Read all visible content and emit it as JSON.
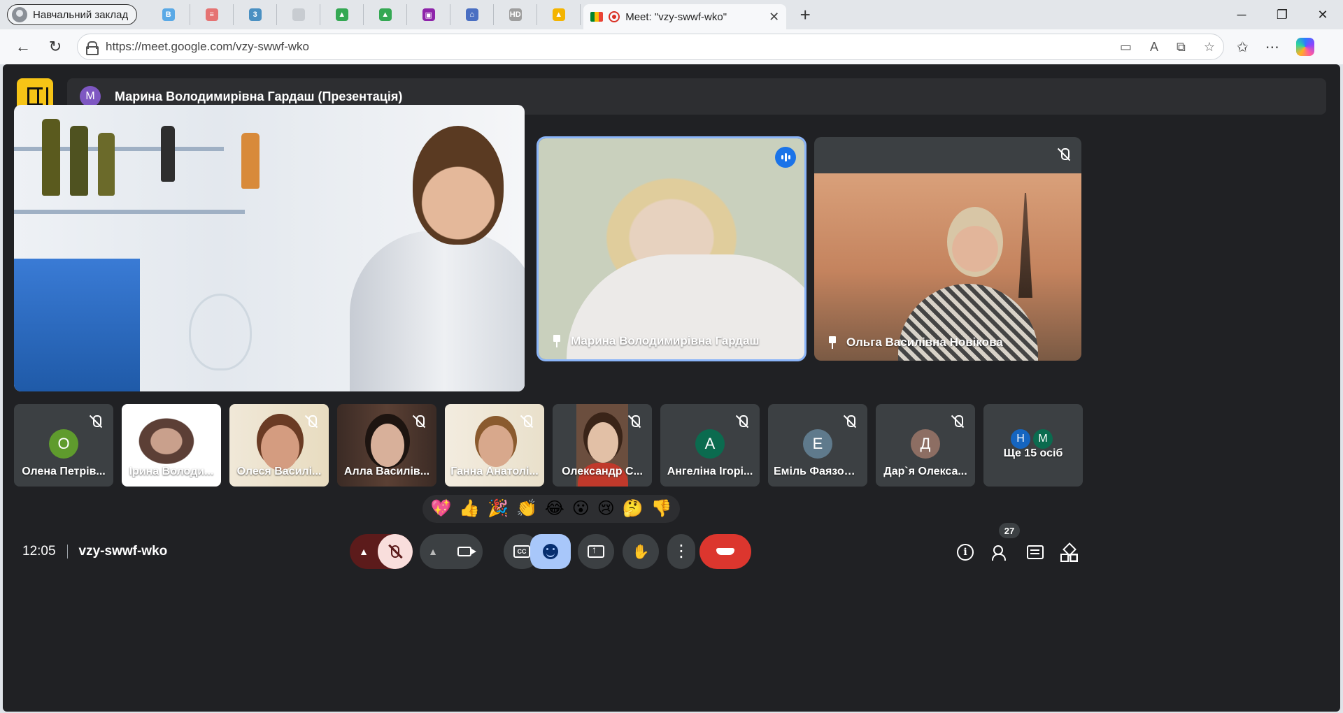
{
  "browser": {
    "profile_label": "Навчальний заклад",
    "mini_tabs": [
      {
        "icon": "bookmark-b-icon",
        "color": "#5aa9e6",
        "glyph": "B"
      },
      {
        "icon": "book-icon",
        "color": "#e57373",
        "glyph": "≡"
      },
      {
        "icon": "calendar-icon",
        "color": "#4a90c2",
        "glyph": "3"
      },
      {
        "icon": "blank-tab-icon",
        "color": "#c8ccd1",
        "glyph": ""
      },
      {
        "icon": "drive-icon",
        "color": "#34a853",
        "glyph": "▲"
      },
      {
        "icon": "drive-icon-2",
        "color": "#34a853",
        "glyph": "▲"
      },
      {
        "icon": "contacts-icon",
        "color": "#8e24aa",
        "glyph": "▣"
      },
      {
        "icon": "home-icon",
        "color": "#4a6fc2",
        "glyph": "⌂"
      },
      {
        "icon": "hd-icon",
        "color": "#9e9e9e",
        "glyph": "HD"
      },
      {
        "icon": "bell-icon",
        "color": "#f4b400",
        "glyph": "▲"
      }
    ],
    "active_tab_title": "Meet: \"vzy-swwf-wko\"",
    "url": "https://meet.google.com/vzy-swwf-wko"
  },
  "meet": {
    "presenter_avatar_letter": "M",
    "presenter_label": "Марина Володимирівна Гардаш (Презентація)",
    "featured": [
      {
        "name": "Марина Володимирівна Гардаш"
      },
      {
        "name": "Ольга Василівна Новікова"
      }
    ],
    "strip": [
      {
        "name": "Олена Петрів...",
        "avatar_letter": "О",
        "avatar_color": "#5f9b2d"
      },
      {
        "name": "Ірина Володи..."
      },
      {
        "name": "Олеся Василі..."
      },
      {
        "name": "Алла Василів..."
      },
      {
        "name": "Ганна Анатолі..."
      },
      {
        "name": "Олександр С..."
      },
      {
        "name": "Ангеліна Ігорі...",
        "avatar_letter": "А",
        "avatar_color": "#0b6b4f"
      },
      {
        "name": "Еміль Фаязові...",
        "avatar_letter": "Е",
        "avatar_color": "#5f7a8c"
      },
      {
        "name": "Дар`я Олекса...",
        "avatar_letter": "Д",
        "avatar_color": "#8d6e63"
      }
    ],
    "more": {
      "label": "Ще 15 осіб",
      "avatars": [
        {
          "letter": "Н",
          "color": "#1565c0"
        },
        {
          "letter": "М",
          "color": "#0b6b4f"
        }
      ]
    },
    "reactions": [
      "💖",
      "👍",
      "🎉",
      "👏",
      "😂",
      "😮",
      "😢",
      "🤔",
      "👎"
    ],
    "time": "12:05",
    "meeting_code": "vzy-swwf-wko",
    "participant_count": "27"
  }
}
